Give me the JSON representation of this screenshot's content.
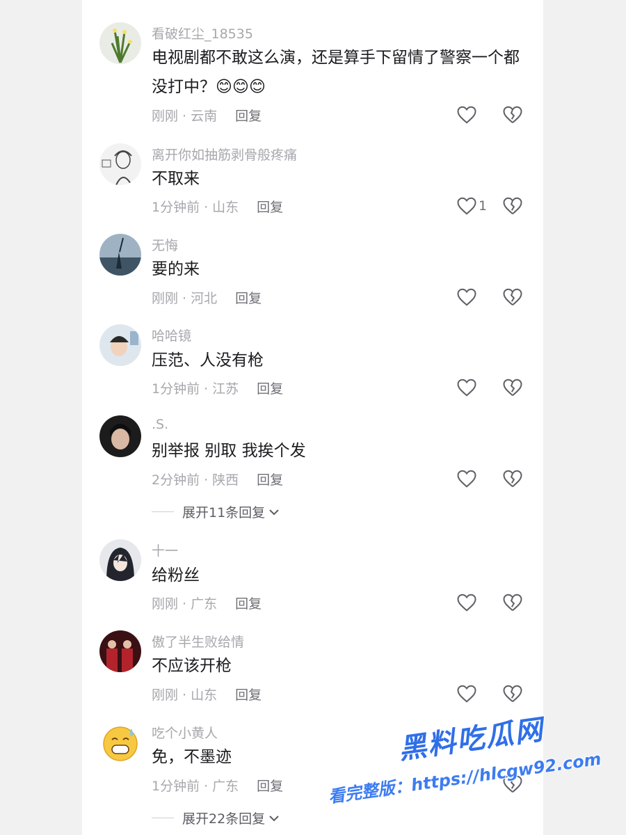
{
  "comments": [
    {
      "username": "看破红尘_18535",
      "text": "电视剧都不敢这么演，还是算手下留情了警察一个都没打中？",
      "emoji": "😊😊😊",
      "time": "刚刚",
      "location": "云南",
      "reply": "回复",
      "likes": ""
    },
    {
      "username": "离开你如抽筋剥骨般疼痛",
      "text": "不取来",
      "time": "1分钟前",
      "location": "山东",
      "reply": "回复",
      "likes": "1"
    },
    {
      "username": "无悔",
      "text": "要的来",
      "time": "刚刚",
      "location": "河北",
      "reply": "回复",
      "likes": ""
    },
    {
      "username": "哈哈镜",
      "text": "压范、人没有枪",
      "time": "1分钟前",
      "location": "江苏",
      "reply": "回复",
      "likes": ""
    },
    {
      "username": ".S.",
      "text": "别举报 别取 我挨个发",
      "time": "2分钟前",
      "location": "陕西",
      "reply": "回复",
      "likes": "",
      "expand": "展开11条回复"
    },
    {
      "username": "十一",
      "text": "给粉丝",
      "time": "刚刚",
      "location": "广东",
      "reply": "回复",
      "likes": ""
    },
    {
      "username": "傲了半生败给情",
      "text": "不应该开枪",
      "time": "刚刚",
      "location": "山东",
      "reply": "回复",
      "likes": ""
    },
    {
      "username": "吃个小黄人",
      "text": "免，不墨迹",
      "time": "1分钟前",
      "location": "广东",
      "reply": "回复",
      "likes": "",
      "expand": "展开22条回复"
    }
  ],
  "separator": "·",
  "watermark": {
    "brand": "黑料吃瓜网",
    "line2": "看完整版：https://hlcgw92.com"
  },
  "colors": {
    "accent_watermark": "#2f6fe8",
    "text": "#1b1b1f",
    "muted": "#a7a7ad"
  },
  "icons": {
    "like": "heart-outline-icon",
    "dislike": "broken-heart-icon",
    "expand": "chevron-down-icon"
  }
}
